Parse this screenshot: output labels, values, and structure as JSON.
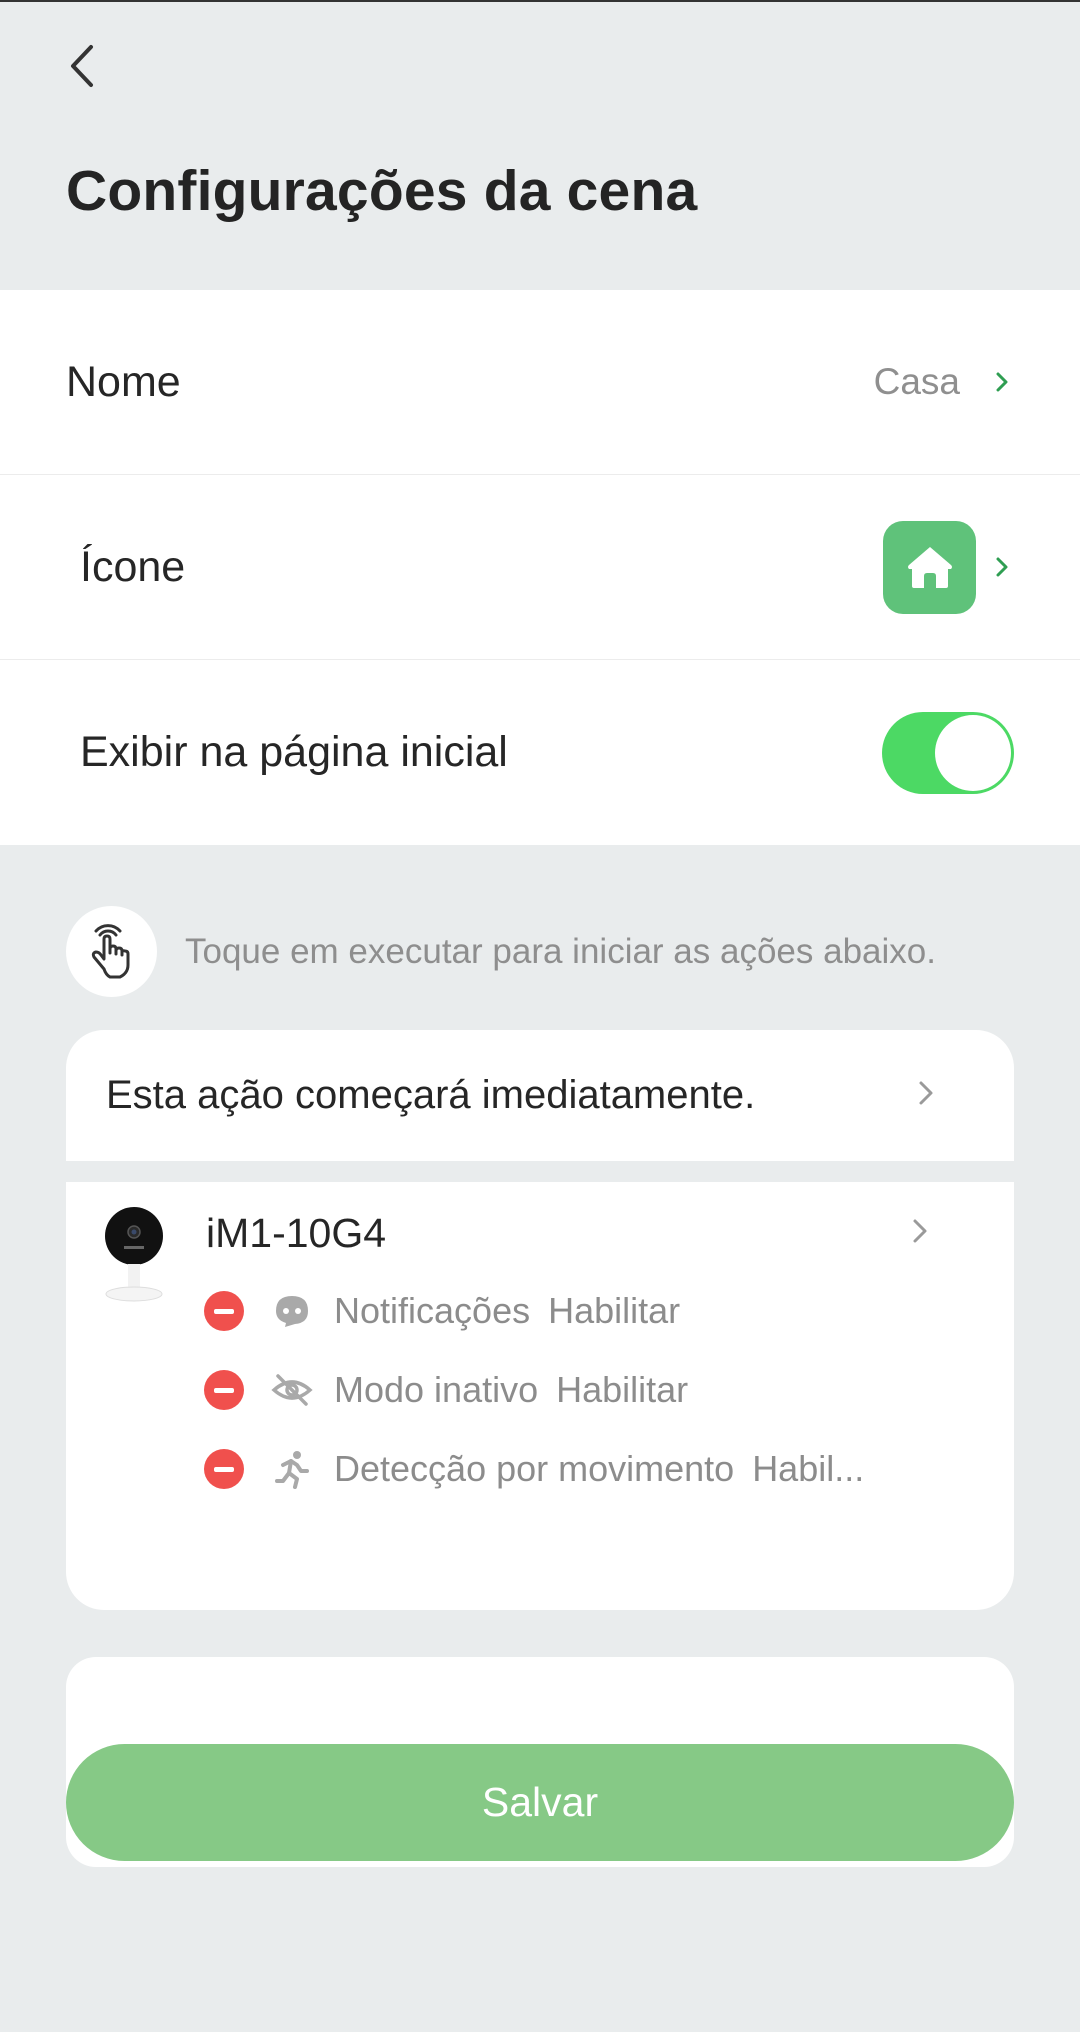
{
  "header": {
    "title": "Configurações da cena"
  },
  "settings": {
    "name": {
      "label": "Nome",
      "value": "Casa"
    },
    "icon": {
      "label": "Ícone",
      "icon": "home-icon",
      "color": "#5fc27a"
    },
    "show_home": {
      "label": "Exibir na página inicial",
      "enabled": true,
      "color": "#4cd964"
    }
  },
  "hint": {
    "icon": "tap-hand-icon",
    "text": "Toque em executar para iniciar as ações abaixo."
  },
  "actions_card": {
    "header": "Esta ação começará imediatamente.",
    "device": {
      "name": "iM1-10G4",
      "actions": [
        {
          "icon": "notification-bubble-icon",
          "label": "Notificações",
          "value": "Habilitar"
        },
        {
          "icon": "eye-off-icon",
          "label": "Modo inativo",
          "value": "Habilitar"
        },
        {
          "icon": "running-person-icon",
          "label": "Detecção por movimento",
          "value": "Habil..."
        }
      ]
    }
  },
  "save_button": {
    "label": "Salvar",
    "color": "#86c986"
  }
}
